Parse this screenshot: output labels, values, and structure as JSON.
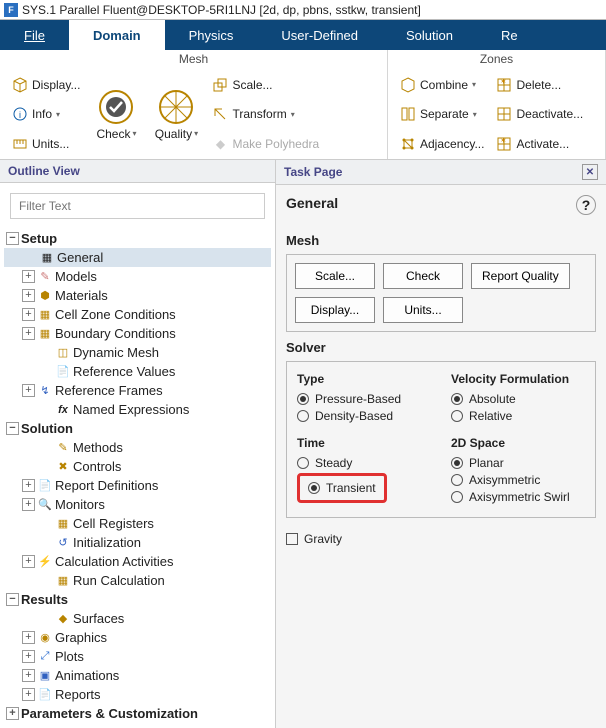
{
  "title": "SYS.1 Parallel Fluent@DESKTOP-5RI1LNJ  [2d, dp, pbns, sstkw, transient]",
  "app_icon": "F",
  "menu": {
    "file": "File",
    "domain": "Domain",
    "physics": "Physics",
    "userdef": "User-Defined",
    "solution": "Solution",
    "results": "Re"
  },
  "ribbon": {
    "mesh": {
      "label": "Mesh",
      "display": "Display...",
      "info": "Info",
      "units": "Units...",
      "check": "Check",
      "quality": "Quality",
      "scale": "Scale...",
      "transform": "Transform",
      "makepoly": "Make Polyhedra"
    },
    "zones": {
      "label": "Zones",
      "combine": "Combine",
      "separate": "Separate",
      "adjacency": "Adjacency...",
      "delete": "Delete...",
      "deactivate": "Deactivate...",
      "activate": "Activate..."
    }
  },
  "outline": {
    "header": "Outline View",
    "filter_ph": "Filter Text",
    "setup": "Setup",
    "general": "General",
    "models": "Models",
    "materials": "Materials",
    "cellzone": "Cell Zone Conditions",
    "boundary": "Boundary Conditions",
    "dynmesh": "Dynamic Mesh",
    "refvals": "Reference Values",
    "refframes": "Reference Frames",
    "namedexp": "Named Expressions",
    "solution": "Solution",
    "methods": "Methods",
    "controls": "Controls",
    "reportdefs": "Report Definitions",
    "monitors": "Monitors",
    "cellregs": "Cell Registers",
    "init": "Initialization",
    "calcact": "Calculation Activities",
    "runcalc": "Run Calculation",
    "results": "Results",
    "surfaces": "Surfaces",
    "graphics": "Graphics",
    "plots": "Plots",
    "animations": "Animations",
    "reports": "Reports",
    "params": "Parameters & Customization"
  },
  "task": {
    "header": "Task Page",
    "title": "General",
    "mesh": "Mesh",
    "scale": "Scale...",
    "check": "Check",
    "repq": "Report Quality",
    "display": "Display...",
    "units": "Units...",
    "solver": "Solver",
    "type": "Type",
    "pb": "Pressure-Based",
    "db": "Density-Based",
    "vf": "Velocity Formulation",
    "abs": "Absolute",
    "rel": "Relative",
    "time": "Time",
    "steady": "Steady",
    "transient": "Transient",
    "space": "2D Space",
    "planar": "Planar",
    "axi": "Axisymmetric",
    "axiswirl": "Axisymmetric Swirl",
    "gravity": "Gravity"
  }
}
